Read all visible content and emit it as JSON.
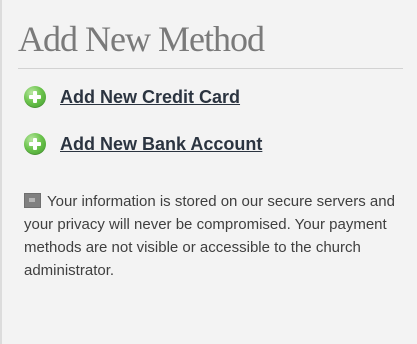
{
  "section": {
    "title": "Add New Method",
    "actions": [
      {
        "label": "Add New Credit Card",
        "icon": "plus-circle-icon"
      },
      {
        "label": "Add New Bank Account",
        "icon": "plus-circle-icon"
      }
    ],
    "info": {
      "icon": "lock-icon",
      "text": "Your information is stored on our secure servers and your privacy will never be compromised. Your payment methods are not visible or accessible to the church administrator."
    }
  },
  "colors": {
    "title": "#7a7a7a",
    "link": "#2b3440",
    "icon_green": "#6cc44d",
    "background": "#f3f3f3"
  }
}
